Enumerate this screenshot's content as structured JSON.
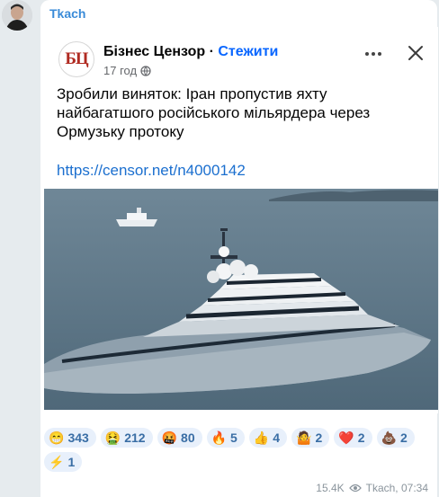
{
  "message": {
    "author": "Tkach",
    "views": "15.4K",
    "signature": "Tkach, 07:34"
  },
  "facebook_post": {
    "page_name": "Бізнес Цензор",
    "separator": "·",
    "follow_label": "Стежити",
    "time_ago": "17 год",
    "logo_text": "БЦ",
    "text": "Зробили виняток: Іран пропустив яхту найбагатшого російського мільярдера через Ормузьку протоку",
    "link": "https://censor.net/n4000142"
  },
  "reactions": [
    {
      "emoji": "😁",
      "count": "343",
      "icon": "grin-emoji"
    },
    {
      "emoji": "🤮",
      "count": "212",
      "icon": "vomit-emoji"
    },
    {
      "emoji": "🤬",
      "count": "80",
      "icon": "swearing-emoji"
    },
    {
      "emoji": "🔥",
      "count": "5",
      "icon": "fire-emoji"
    },
    {
      "emoji": "👍",
      "count": "4",
      "icon": "thumbs-up-emoji"
    },
    {
      "emoji": "🤷",
      "count": "2",
      "icon": "shrug-emoji"
    },
    {
      "emoji": "❤️",
      "count": "2",
      "icon": "heart-emoji"
    },
    {
      "emoji": "💩",
      "count": "2",
      "icon": "poop-emoji"
    },
    {
      "emoji": "⚡",
      "count": "1",
      "icon": "lightning-emoji"
    }
  ],
  "colors": {
    "author": "#3a8bd8",
    "follow": "#0866ff",
    "link": "#1b6fcf",
    "reaction_bg": "#e8f0fb"
  }
}
